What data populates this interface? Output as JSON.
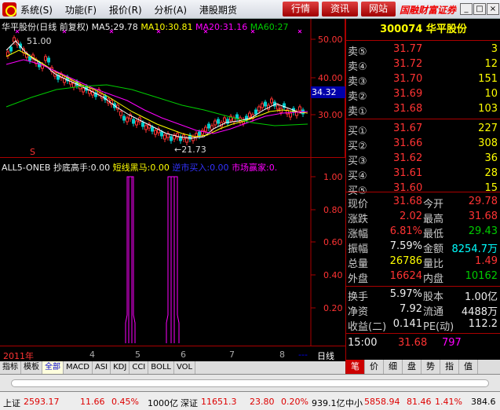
{
  "menu": [
    "系统(S)",
    "功能(F)",
    "报价(R)",
    "分析(A)",
    "港股期货"
  ],
  "topbuttons": [
    "行情",
    "资讯",
    "网站"
  ],
  "brand": "国融财富证券",
  "kline": {
    "title": "华平股份(日线 前复权)",
    "ma5": "MA5:29.78",
    "ma10": "MA10:30.81",
    "ma20": "MA20:31.16",
    "ma60": "MA60:27",
    "high_mark": "51.00",
    "low_mark": "←21.73",
    "yaxis": [
      "50.00",
      "40.00",
      "34.32",
      "30.00"
    ]
  },
  "indicator": {
    "name": "ALL5-ONEB",
    "v1": "抄底高手:0.00",
    "v2": "短线黑马:0.00",
    "v3": "逆市买入:0.00",
    "v4": "市场赢家:0.",
    "yaxis": [
      "1.00",
      "0.80",
      "0.60",
      "0.40",
      "0.20"
    ]
  },
  "xaxis": [
    "2011年",
    "4",
    "5",
    "6",
    "7",
    "8",
    "---"
  ],
  "period": "日线",
  "btabs": [
    "指标",
    "模板",
    "全部",
    "MACD",
    "ASI",
    "KDJ",
    "CCI",
    "BOLL",
    "VOL"
  ],
  "stock": {
    "code": "300074",
    "name": "华平股份"
  },
  "sells": [
    {
      "label": "卖⑤",
      "price": "31.77",
      "vol": "3"
    },
    {
      "label": "卖④",
      "price": "31.72",
      "vol": "12"
    },
    {
      "label": "卖③",
      "price": "31.70",
      "vol": "151"
    },
    {
      "label": "卖②",
      "price": "31.69",
      "vol": "10"
    },
    {
      "label": "卖①",
      "price": "31.68",
      "vol": "103"
    }
  ],
  "buys": [
    {
      "label": "买①",
      "price": "31.67",
      "vol": "227"
    },
    {
      "label": "买②",
      "price": "31.66",
      "vol": "308"
    },
    {
      "label": "买③",
      "price": "31.62",
      "vol": "36"
    },
    {
      "label": "买④",
      "price": "31.61",
      "vol": "28"
    },
    {
      "label": "买⑤",
      "price": "31.60",
      "vol": "15"
    }
  ],
  "quote": {
    "now_l": "现价",
    "now": "31.68",
    "open_l": "今开",
    "open": "29.78",
    "chg_l": "涨跌",
    "chg": "2.02",
    "high_l": "最高",
    "high": "31.68",
    "pct_l": "涨幅",
    "pct": "6.81%",
    "low_l": "最低",
    "low": "29.43",
    "amp_l": "振幅",
    "amp": "7.59%",
    "amt_l": "金额",
    "amt": "8254.7万",
    "vol_l": "总量",
    "vol": "26786",
    "ratio_l": "量比",
    "ratio": "1.49",
    "out_l": "外盘",
    "out": "16624",
    "in_l": "内盘",
    "in": "10162",
    "turn_l": "换手",
    "turn": "5.97%",
    "cap_l": "股本",
    "cap": "1.00亿",
    "na_l": "净资",
    "na": "7.92",
    "float_l": "流通",
    "float": "4488万",
    "eps_l": "收益(二)",
    "eps": "0.141",
    "pe_l": "PE(动)",
    "pe": "112.2"
  },
  "tick": {
    "time": "15:00",
    "price": "31.68",
    "vol": "797",
    "mark": "S"
  },
  "rtabs": [
    "笔",
    "价",
    "细",
    "盘",
    "势",
    "指",
    "值"
  ],
  "status": {
    "sh_l": "上证",
    "sh": "2593.17",
    "sh_c": "11.66",
    "sh_p": "0.45%",
    "sh_a": "1000亿",
    "sz_l": "深证",
    "sz": "11651.3",
    "sz_c": "23.80",
    "sz_p": "0.20%",
    "sz_a": "939.1亿",
    "zx_l": "中小",
    "zx": "5858.94",
    "zx_c": "81.46",
    "zx_p": "1.41%",
    "zx_a": "384.6"
  }
}
